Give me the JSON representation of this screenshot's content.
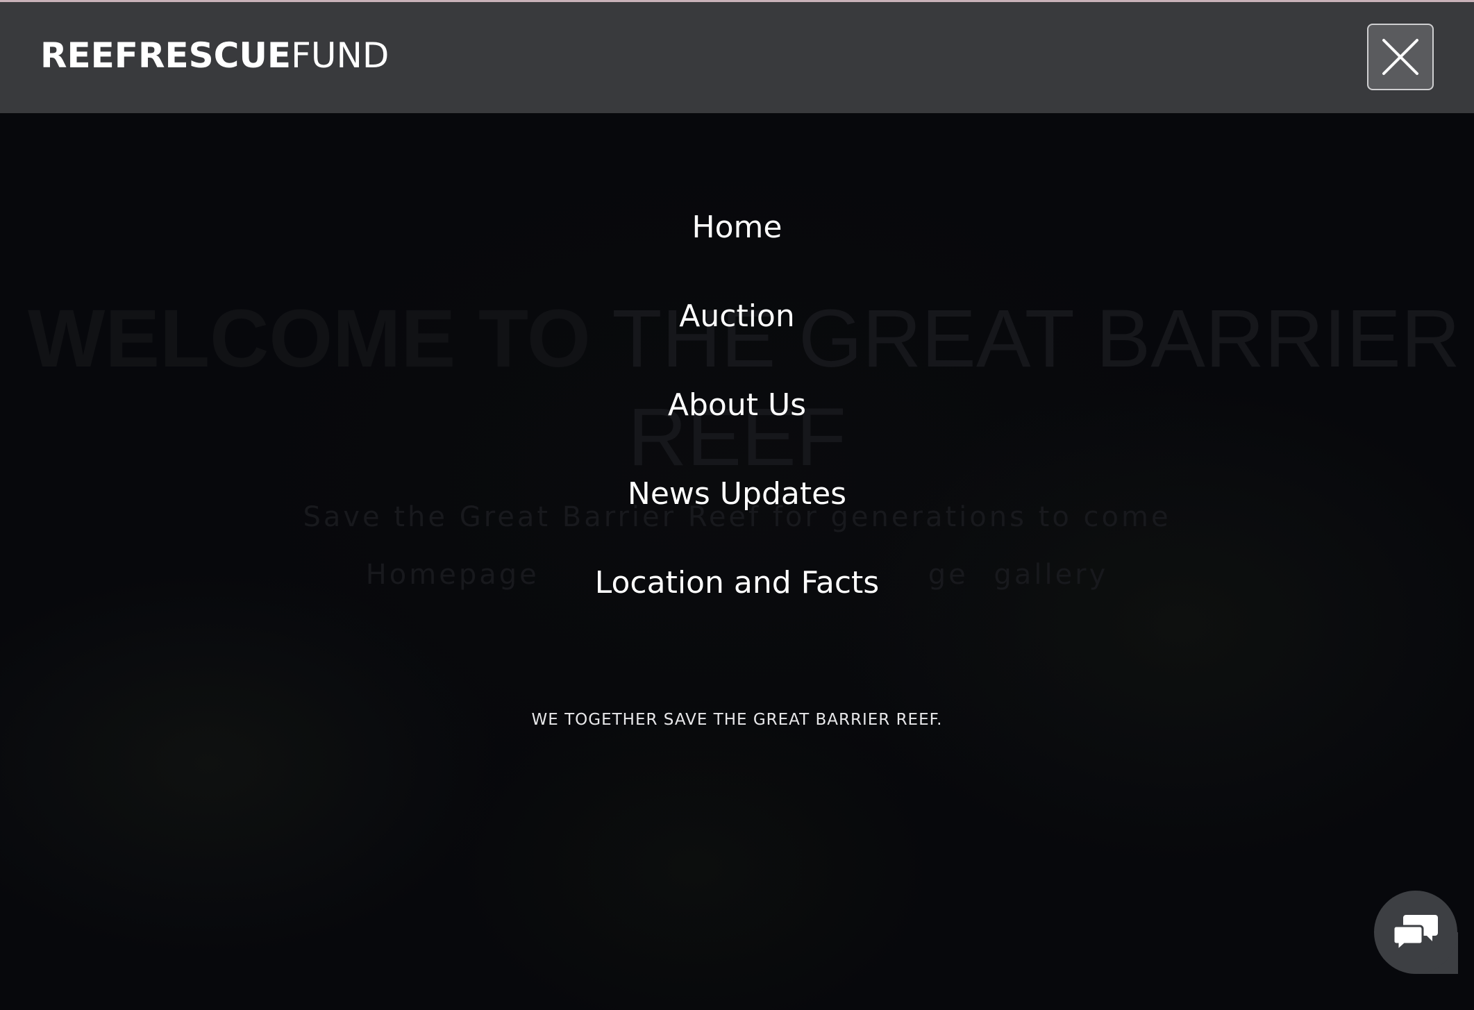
{
  "header": {
    "logo_bold": "REEFRESCUE",
    "logo_light": "FUND",
    "close_icon": "close-icon"
  },
  "hero_background": {
    "title_bold": "WELCOME TO",
    "title_light": " THE GREAT BARRIER",
    "title_line2": "REEF",
    "subtitle": "Save the Great Barrier Reef for generations to come",
    "links_left": "Homepage",
    "links_right": "ge gallery"
  },
  "menu": {
    "items": [
      {
        "label": "Home"
      },
      {
        "label": "Auction"
      },
      {
        "label": "About Us"
      },
      {
        "label": "News Updates"
      },
      {
        "label": "Location and Facts"
      }
    ]
  },
  "tagline": "WE TOGETHER SAVE THE GREAT BARRIER REEF.",
  "chat": {
    "icon": "chat-bubbles-icon"
  },
  "colors": {
    "header_bg": "#393a3d",
    "overlay_bg": "#07080c",
    "text": "#ffffff",
    "accent_line": "#c9b2b9"
  }
}
